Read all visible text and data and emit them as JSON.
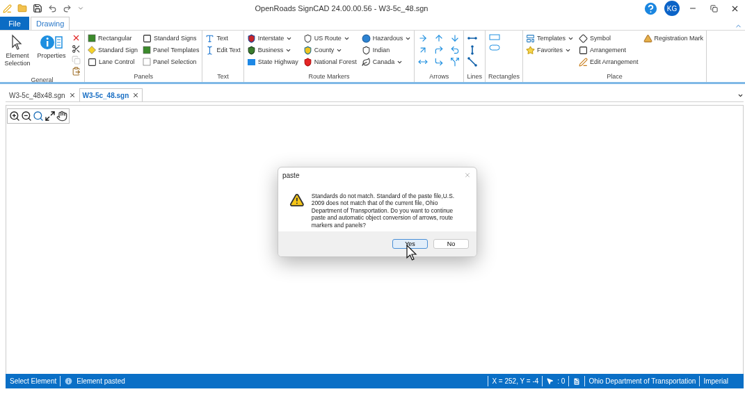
{
  "window": {
    "title": "OpenRoads SignCAD 24.00.00.56 - W3-5c_48.sgn",
    "user_initials": "KG"
  },
  "ribbon_tabs": [
    {
      "label": "File",
      "kind": "file",
      "selected": false
    },
    {
      "label": "Drawing",
      "kind": "tab",
      "selected": true
    }
  ],
  "groups": [
    {
      "label": "General",
      "columns": [
        [
          {
            "kind": "large",
            "label": "Element Selection"
          }
        ],
        [
          {
            "kind": "large",
            "label": "Properties"
          }
        ],
        [
          {
            "kind": "icon"
          },
          {
            "kind": "icon"
          },
          {
            "kind": "icon",
            "disabled": true
          },
          {
            "kind": "icon"
          }
        ]
      ]
    },
    {
      "label": "Panels",
      "columns": [
        [
          {
            "kind": "small",
            "label": "Rectangular"
          },
          {
            "kind": "small",
            "label": "Standard Sign"
          },
          {
            "kind": "small",
            "label": "Lane Control"
          }
        ],
        [
          {
            "kind": "small",
            "label": "Standard Signs"
          },
          {
            "kind": "small",
            "label": "Panel Templates"
          },
          {
            "kind": "small",
            "label": "Panel Selection"
          }
        ]
      ]
    },
    {
      "label": "Text",
      "columns": [
        [
          {
            "kind": "small",
            "label": "Text"
          },
          {
            "kind": "small",
            "label": "Edit Text"
          }
        ]
      ]
    },
    {
      "label": "Route Markers",
      "columns": [
        [
          {
            "kind": "small",
            "label": "Interstate",
            "has_menu": true
          },
          {
            "kind": "small",
            "label": "Business",
            "has_menu": true
          },
          {
            "kind": "small",
            "label": "State Highway"
          }
        ],
        [
          {
            "kind": "small",
            "label": "US Route",
            "has_menu": true
          },
          {
            "kind": "small",
            "label": "County",
            "has_menu": true
          },
          {
            "kind": "small",
            "label": "National Forest"
          }
        ],
        [
          {
            "kind": "small",
            "label": "Hazardous",
            "has_menu": true
          },
          {
            "kind": "small",
            "label": "Indian"
          },
          {
            "kind": "small",
            "label": "Canada",
            "has_menu": true
          }
        ]
      ]
    },
    {
      "label": "Arrows",
      "columns": [
        [
          {
            "kind": "icon"
          },
          {
            "kind": "icon"
          },
          {
            "kind": "icon"
          }
        ],
        [
          {
            "kind": "icon"
          },
          {
            "kind": "icon"
          },
          {
            "kind": "icon"
          }
        ],
        [
          {
            "kind": "icon"
          },
          {
            "kind": "icon"
          },
          {
            "kind": "icon"
          }
        ]
      ]
    },
    {
      "label": "Lines",
      "columns": [
        [
          {
            "kind": "icon"
          },
          {
            "kind": "icon"
          },
          {
            "kind": "icon"
          }
        ]
      ]
    },
    {
      "label": "Rectangles",
      "columns": [
        [
          {
            "kind": "icon"
          },
          {
            "kind": "icon"
          }
        ]
      ]
    },
    {
      "label": "Place",
      "columns": [
        [
          {
            "kind": "small",
            "label": "Templates",
            "has_menu": true
          },
          {
            "kind": "small",
            "label": "Favorites",
            "has_menu": true
          }
        ],
        [
          {
            "kind": "small",
            "label": "Symbol"
          },
          {
            "kind": "small",
            "label": "Arrangement"
          },
          {
            "kind": "small",
            "label": "Edit Arrangement"
          }
        ],
        [
          {
            "kind": "small",
            "label": "Registration Mark"
          }
        ]
      ]
    }
  ],
  "doc_tabs": [
    {
      "label": "W3-5c_48x48.sgn",
      "selected": false
    },
    {
      "label": "W3-5c_48.sgn",
      "selected": true
    }
  ],
  "dialog": {
    "title": "paste",
    "message": "Standards do not match. Standard of the paste file,U.S. 2009 does not match that of the current file, Ohio Department of Transportation.  Do you want to continue paste and automatic object conversion of arrows, route markers and panels?",
    "buttons": [
      {
        "label": "Yes",
        "selected": true
      },
      {
        "label": "No",
        "selected": false
      }
    ]
  },
  "status_bar": {
    "mode": "Select Element",
    "message": "Element pasted",
    "coordinates": "X = 252, Y = -4",
    "selection_count": ": 0",
    "standard": "Ohio Department of Transportation",
    "units": "Imperial"
  }
}
